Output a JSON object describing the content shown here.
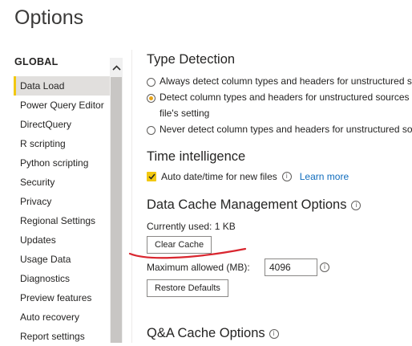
{
  "page": {
    "title": "Options"
  },
  "sidebar": {
    "heading": "GLOBAL",
    "items": [
      {
        "label": "Data Load"
      },
      {
        "label": "Power Query Editor"
      },
      {
        "label": "DirectQuery"
      },
      {
        "label": "R scripting"
      },
      {
        "label": "Python scripting"
      },
      {
        "label": "Security"
      },
      {
        "label": "Privacy"
      },
      {
        "label": "Regional Settings"
      },
      {
        "label": "Updates"
      },
      {
        "label": "Usage Data"
      },
      {
        "label": "Diagnostics"
      },
      {
        "label": "Preview features"
      },
      {
        "label": "Auto recovery"
      },
      {
        "label": "Report settings"
      }
    ],
    "active_index": 0
  },
  "type_detection": {
    "title": "Type Detection",
    "options": [
      {
        "label": "Always detect column types and headers for unstructured so",
        "checked": false
      },
      {
        "label_line1": "Detect column types and headers for unstructured sources a",
        "label_line2": "file's setting",
        "checked": true
      },
      {
        "label": "Never detect column types and headers for unstructured so",
        "checked": false
      }
    ]
  },
  "time_intelligence": {
    "title": "Time intelligence",
    "checkbox_label": "Auto date/time for new files",
    "checked": true,
    "learn_more": "Learn more"
  },
  "data_cache": {
    "title": "Data Cache Management Options",
    "currently_used": "Currently used: 1 KB",
    "clear_cache_label": "Clear Cache",
    "max_allowed_label": "Maximum allowed (MB):",
    "max_allowed_value": "4096",
    "restore_defaults_label": "Restore Defaults"
  },
  "qa_cache": {
    "title": "Q&A Cache Options"
  },
  "colors": {
    "accent": "#f2c811",
    "annotation": "#d9262f",
    "link": "#0f6cbd"
  }
}
